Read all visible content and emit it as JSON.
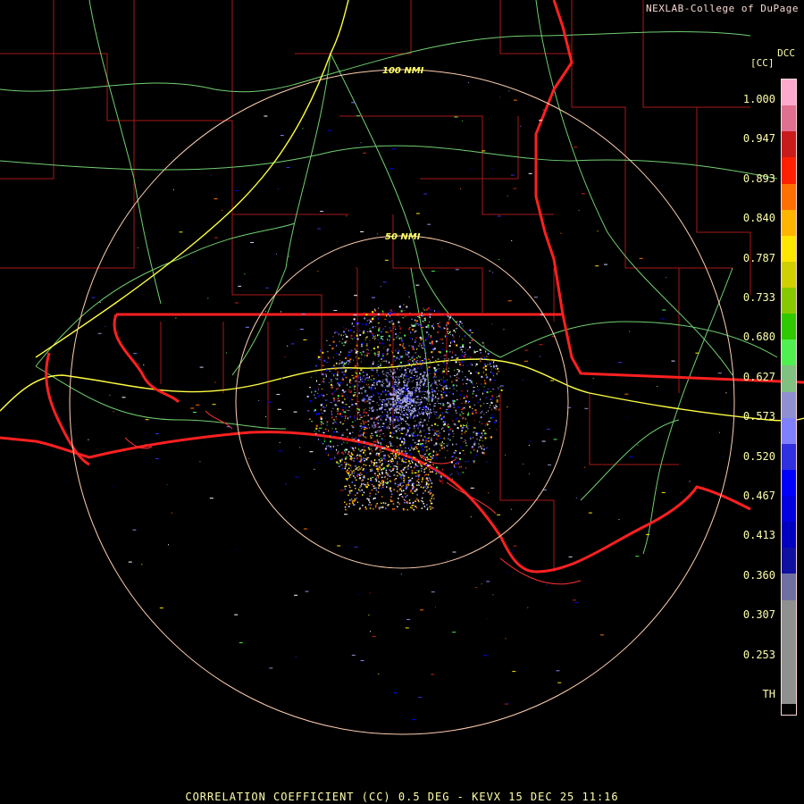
{
  "header": {
    "credit": "NEXLAB-College of DuPage",
    "station_tag": "DCC",
    "units": "[CC]"
  },
  "caption": "CORRELATION COEFFICIENT (CC) 0.5 DEG - KEVX 15 DEC 25 11:16",
  "range_rings": [
    {
      "label": "100 NMI"
    },
    {
      "label": "50 NMI"
    }
  ],
  "legend": {
    "ticks": [
      "1.000",
      "0.947",
      "0.893",
      "0.840",
      "0.787",
      "0.733",
      "0.680",
      "0.627",
      "0.573",
      "0.520",
      "0.467",
      "0.413",
      "0.360",
      "0.307",
      "0.253",
      "TH"
    ],
    "colors": [
      "#ffaacc",
      "#e07090",
      "#c81c1c",
      "#ff2000",
      "#ff7000",
      "#ffb400",
      "#ffe600",
      "#d0d000",
      "#88c800",
      "#30c800",
      "#50f050",
      "#80c080",
      "#9090d0",
      "#8080ff",
      "#3030e0",
      "#0000ff",
      "#0000e0",
      "#0000c0",
      "#1010a0",
      "#7070a0",
      "#909090",
      "#909090",
      "#909090",
      "#909090",
      "#000000"
    ]
  },
  "colors": {
    "state_border": "#ff2020",
    "county": "#b01818",
    "highway": "#ffff40",
    "road": "#80e080",
    "ring": "#ffd0b0"
  }
}
